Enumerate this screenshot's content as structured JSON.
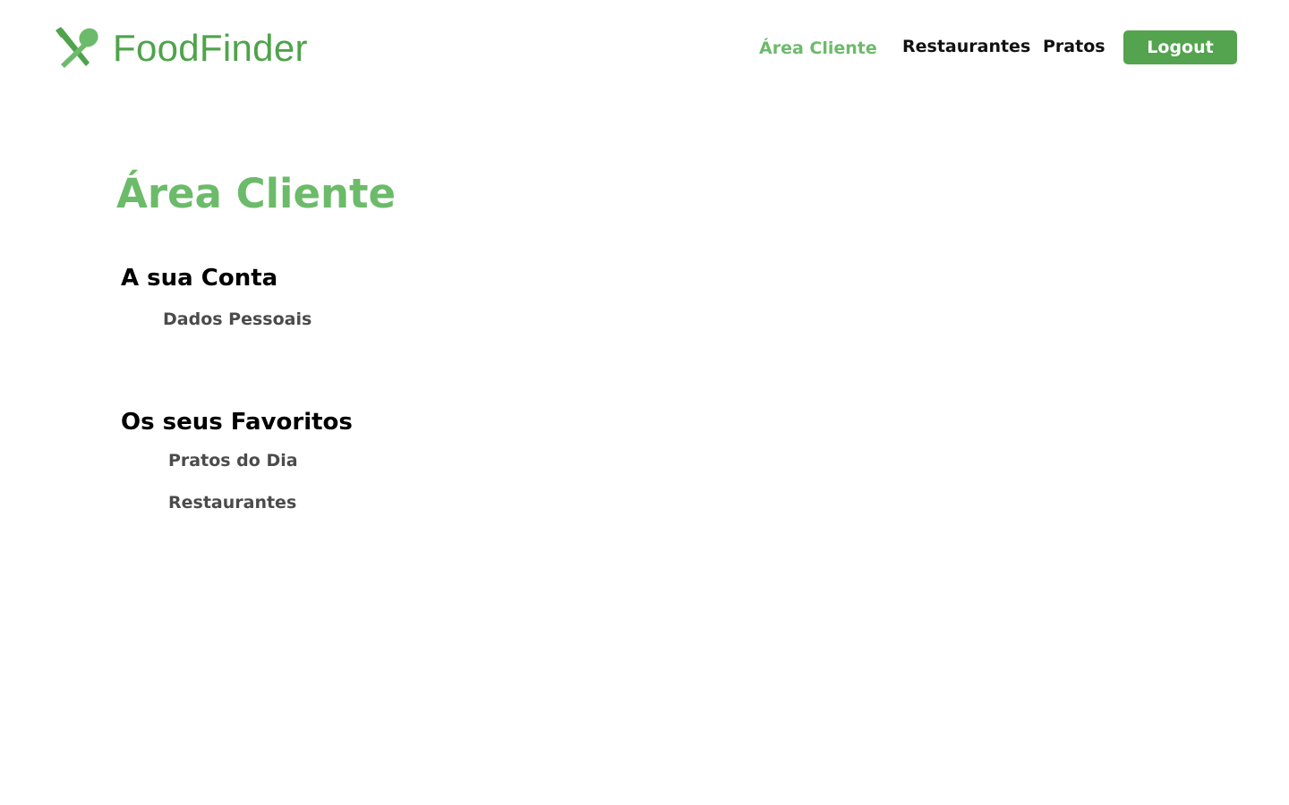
{
  "brand": {
    "name": "FoodFinder",
    "icon": "fork-spoon-icon",
    "color": "#4fa34b"
  },
  "nav": {
    "items": [
      {
        "label": "Área Cliente",
        "active": true
      },
      {
        "label": "Restaurantes",
        "active": false
      },
      {
        "label": "Pratos",
        "active": false
      }
    ],
    "logout_label": "Logout",
    "active_color": "#6cbb6a",
    "button_color": "#54a34e"
  },
  "main": {
    "title": "Área Cliente",
    "sections": [
      {
        "title": "A sua Conta",
        "links": [
          "Dados Pessoais"
        ]
      },
      {
        "title": "Os seus Favoritos",
        "links": [
          "Pratos do Dia",
          "Restaurantes"
        ]
      }
    ]
  }
}
